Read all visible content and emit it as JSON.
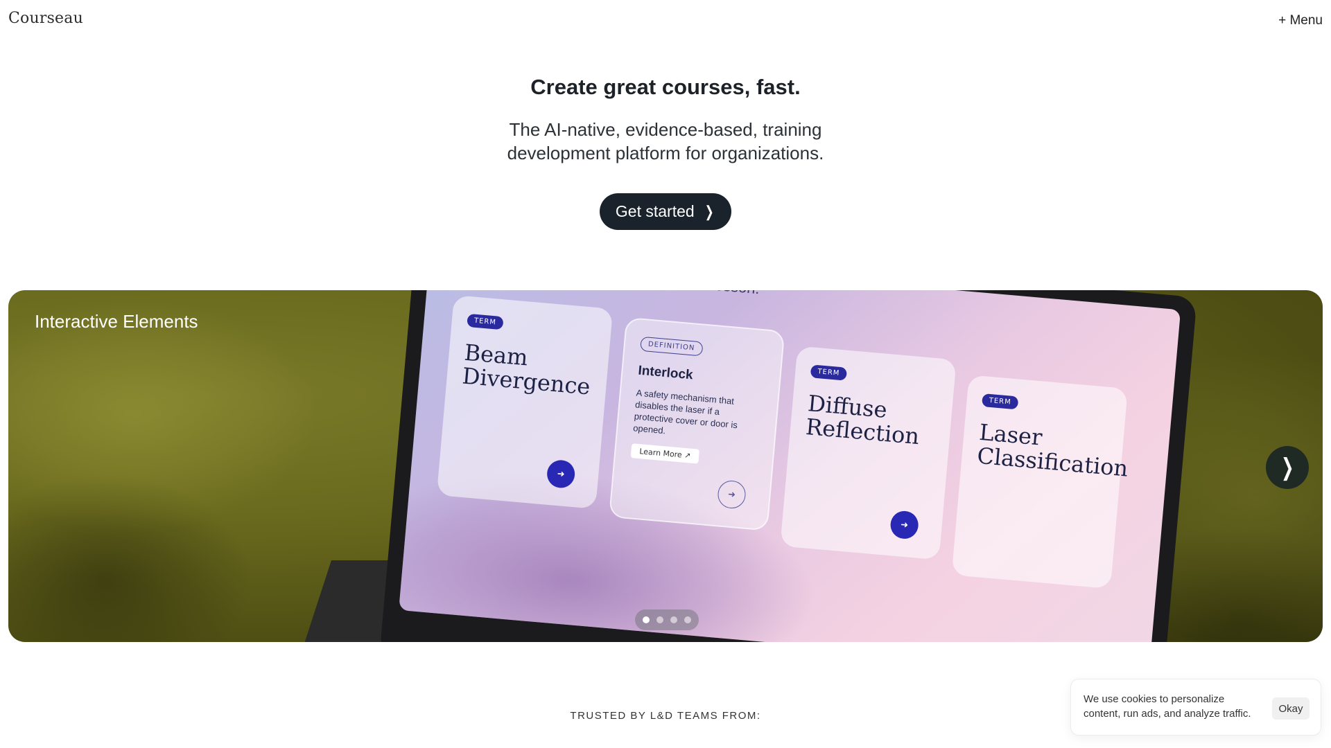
{
  "header": {
    "logo": "Courseau",
    "menu_label": "+ Menu"
  },
  "hero": {
    "title": "Create great courses, fast.",
    "subtitle": "The AI-native, evidence-based, training development platform for organizations.",
    "cta_label": "Get started",
    "cta_icon": "chevron-right"
  },
  "carousel": {
    "slide_label": "Interactive Elements",
    "screen_heading": "ms learned in this lesson.",
    "cards": [
      {
        "tag": "TERM",
        "title": "Beam Divergence"
      },
      {
        "tag": "DEFINITION",
        "term": "Interlock",
        "definition": "A safety mechanism that disables the laser if a protective cover or door is opened.",
        "link": "Learn More ↗"
      },
      {
        "tag": "TERM",
        "title": "Diffuse Reflection"
      },
      {
        "tag": "TERM",
        "title": "Laser Classification"
      }
    ],
    "next_icon": "chevron-right",
    "pagination": {
      "total": 4,
      "active": 1
    }
  },
  "trusted": {
    "label": "TRUSTED BY L&D TEAMS FROM:"
  },
  "cookie": {
    "text": "We use cookies to personalize content, run ads, and analyze traffic.",
    "button_label": "Okay"
  }
}
